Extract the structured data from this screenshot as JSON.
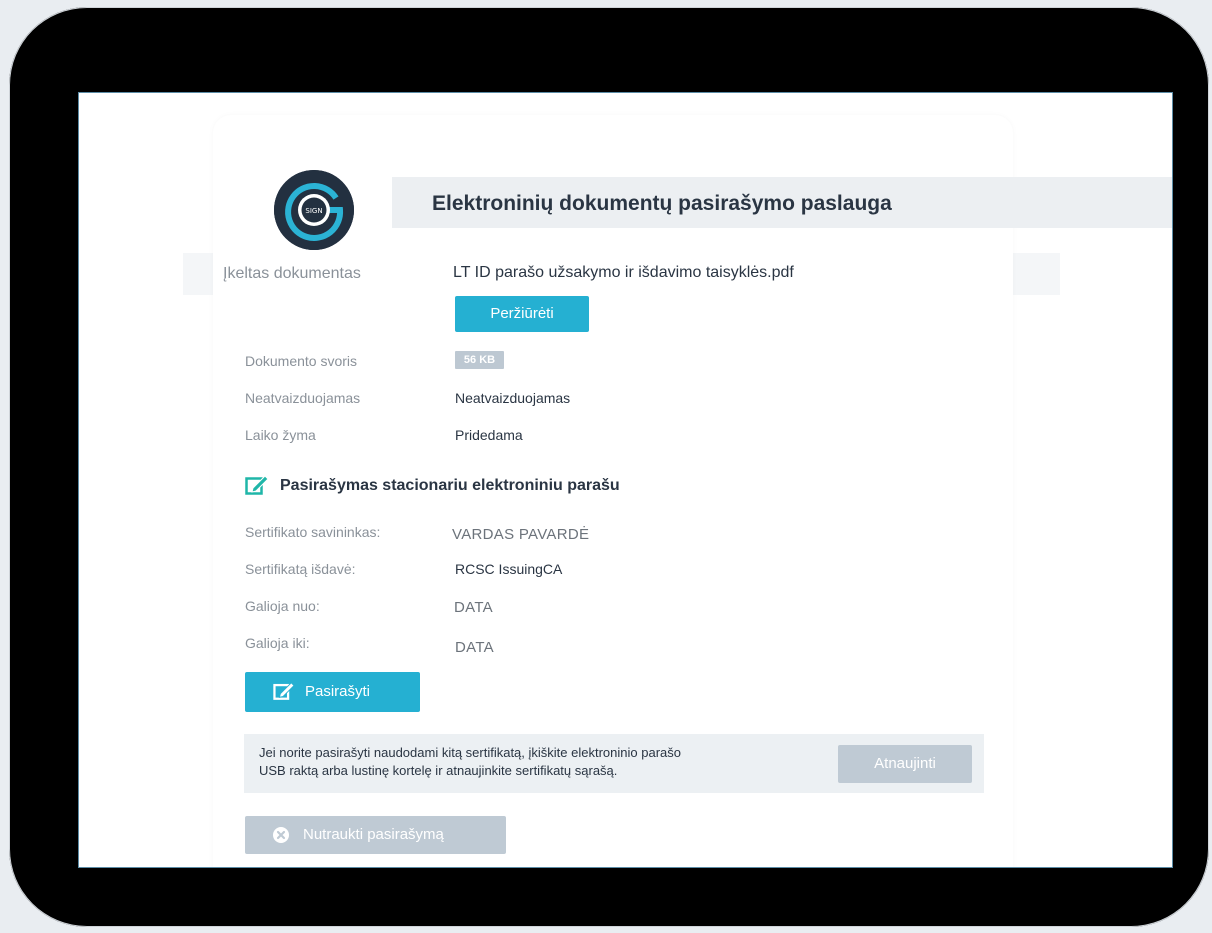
{
  "header": {
    "title": "Elektroninių dokumentų pasirašymo paslauga",
    "logo_text": "SIGN"
  },
  "document": {
    "uploaded_label": "Įkeltas dokumentas",
    "uploaded_value": "LT ID parašo užsakymo ir išdavimo taisyklės.pdf",
    "view_button": "Peržiūrėti",
    "size_label": "Dokumento svoris",
    "size_value": "56 KB",
    "display_label": "Neatvaizduojamas",
    "display_value": "Neatvaizduojamas",
    "timestamp_label": "Laiko žyma",
    "timestamp_value": "Pridedama"
  },
  "signing": {
    "section_title": "Pasirašymas stacionariu elektroniniu parašu",
    "owner_label": "Sertifikato savininkas:",
    "owner_value": "VARDAS PAVARDĖ",
    "issuer_label": "Sertifikatą išdavė:",
    "issuer_value": "RCSC IssuingCA",
    "valid_from_label": "Galioja nuo:",
    "valid_from_value": "DATA",
    "valid_to_label": "Galioja iki:",
    "valid_to_value": "DATA",
    "sign_button": "Pasirašyti"
  },
  "note": {
    "text_line1": "Jei norite pasirašyti naudodami kitą sertifikatą, įkiškite elektroninio parašo",
    "text_line2": "USB raktą arba lustinę kortelę ir atnaujinkite sertifikatų sąrašą.",
    "refresh_button": "Atnaujinti"
  },
  "cancel_button": "Nutraukti pasirašymą",
  "colors": {
    "accent": "#25b0d2",
    "disabled": "#bfcad4",
    "text": "#2a3543",
    "muted": "#8a9199"
  }
}
